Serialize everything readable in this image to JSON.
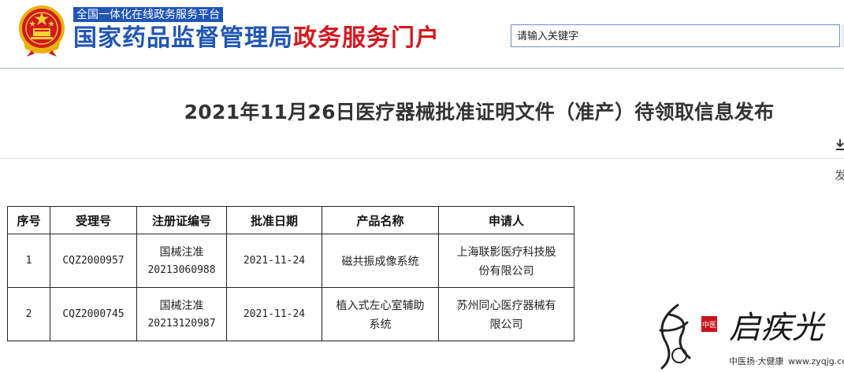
{
  "header": {
    "tagline": "全国一体化在线政务服务平台",
    "title_main": "国家药品监督管理局",
    "title_sub": "政务服务门户",
    "search_placeholder": "请输入关键字",
    "emblem_icon": "national-emblem-icon"
  },
  "article": {
    "title": "2021年11月26日医疗器械批准证明文件（准产）待领取信息发布",
    "side_text": "发",
    "side_icon": "download-icon"
  },
  "table": {
    "headers": [
      "序号",
      "受理号",
      "注册证编号",
      "批准日期",
      "产品名称",
      "申请人"
    ],
    "rows": [
      {
        "index": "1",
        "accept_no": "CQZ2000957",
        "cert_prefix": "国械注准",
        "cert_no": "20213060988",
        "date": "2021-11-24",
        "product_1": "磁共振成像系统",
        "product_2": "",
        "applicant_1": "上海联影医疗科技股",
        "applicant_2": "份有限公司"
      },
      {
        "index": "2",
        "accept_no": "CQZ2000745",
        "cert_prefix": "国械注准",
        "cert_no": "20213120987",
        "date": "2021-11-24",
        "product_1": "植入式左心室辅助",
        "product_2": "系统",
        "applicant_1": "苏州同心医疗器械有",
        "applicant_2": "限公司"
      }
    ]
  },
  "watermark": {
    "seal": "中医",
    "name": "启疾光",
    "slogan": "中医扬·大健康",
    "url": "www.zyqjg.com"
  },
  "colors": {
    "brand_blue": "#1f56b5",
    "brand_red": "#d3181e"
  }
}
